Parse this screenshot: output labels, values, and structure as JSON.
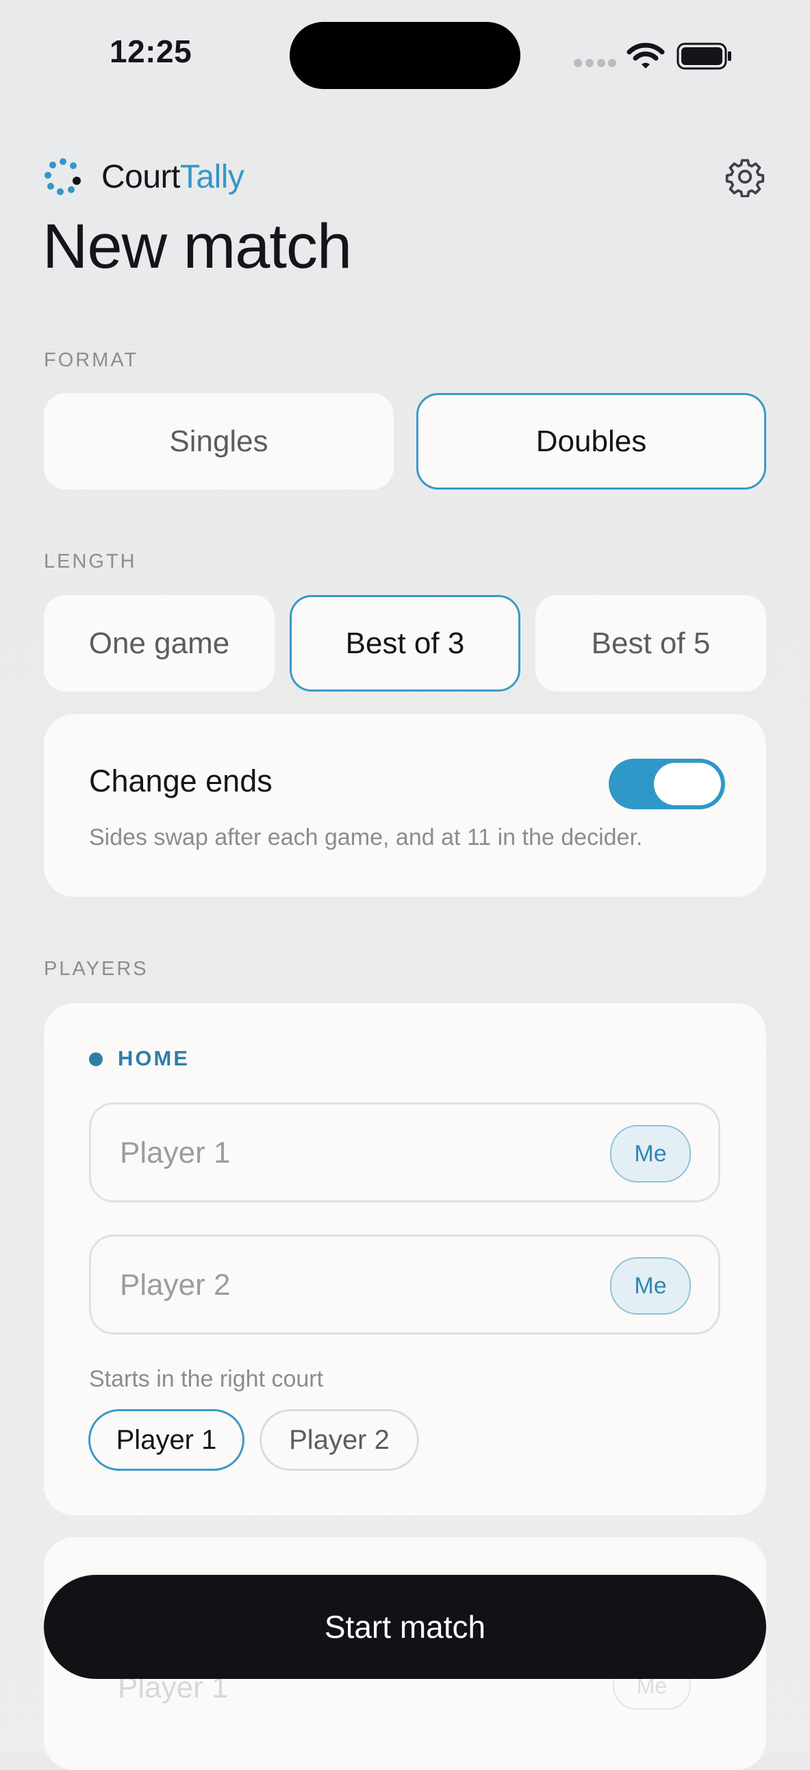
{
  "status_bar": {
    "time": "12:25"
  },
  "header": {
    "brand_part1": "Court",
    "brand_part2": "Tally",
    "title": "New match"
  },
  "format": {
    "label": "FORMAT",
    "options": [
      "Singles",
      "Doubles"
    ],
    "selected": "Doubles"
  },
  "length": {
    "label": "LENGTH",
    "options": [
      "One game",
      "Best of 3",
      "Best of 5"
    ],
    "selected": "Best of 3"
  },
  "change_ends": {
    "title": "Change ends",
    "description": "Sides swap after each game, and at 11 in the decider.",
    "enabled": true
  },
  "players": {
    "label": "PLAYERS",
    "home": {
      "team_label": "HOME",
      "player_placeholders": [
        "Player 1",
        "Player 2"
      ],
      "me_label": "Me",
      "court_label": "Starts in the right court",
      "court_options": [
        "Player 1",
        "Player 2"
      ],
      "court_selected": "Player 1"
    },
    "away_preview": {
      "player_placeholder": "Player 1",
      "me_label": "Me"
    }
  },
  "start_button": "Start match",
  "colors": {
    "accent": "#3a9ac6",
    "home": "#2e7ea6",
    "primary_button": "#111216"
  }
}
